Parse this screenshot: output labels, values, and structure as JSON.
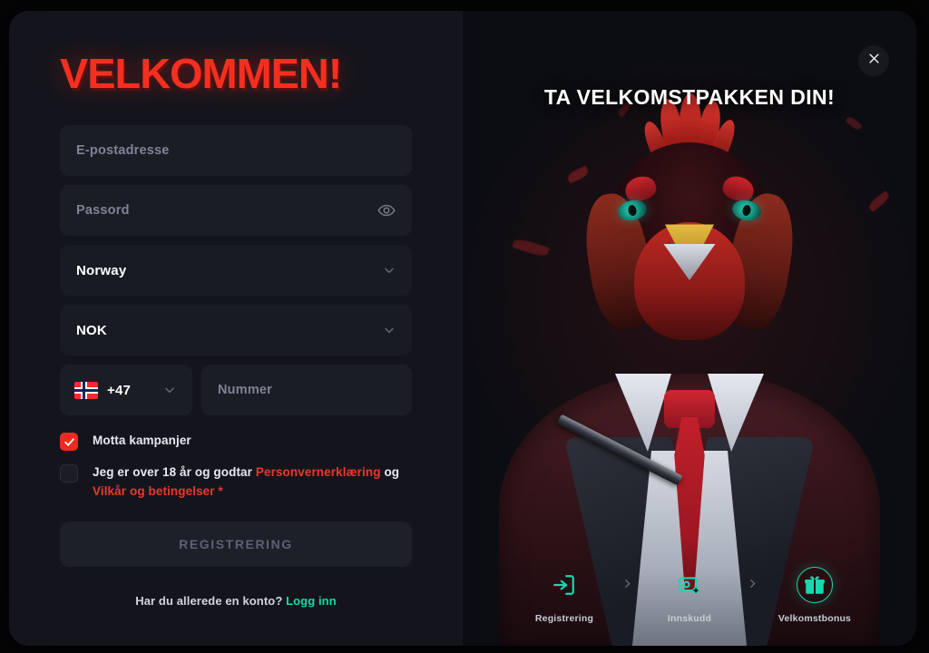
{
  "modal": {
    "close_label": "×",
    "close_icon": "close-icon"
  },
  "form": {
    "title": "VELKOMMEN!",
    "email_placeholder": "E-postadresse",
    "password_placeholder": "Passord",
    "password_toggle_icon": "eye-icon",
    "country_value": "Norway",
    "currency_value": "NOK",
    "country_code_value": "+47",
    "country_flag_icon": "norway-flag-icon",
    "phone_placeholder": "Nummer",
    "chevron_icon": "chevron-down-icon",
    "promo_checkbox": {
      "label": "Motta kampanjer",
      "checked": true
    },
    "terms_checkbox": {
      "text_before": "Jeg er over 18 år og godtar ",
      "link1": "Personvernerklæring",
      "text_middle": " og ",
      "link2": "Vilkår og betingelser",
      "text_after": " *",
      "checked": false
    },
    "submit_label": "REGISTRERING",
    "login_prompt": "Har du allerede en konto?",
    "login_link": "Logg inn"
  },
  "promo": {
    "heading": "TA VELKOMSTPAKKEN DIN!",
    "steps": [
      {
        "label": "Registrering",
        "icon": "login-arrow-icon",
        "active": false
      },
      {
        "label": "Innskudd",
        "icon": "deposit-card-icon",
        "active": false
      },
      {
        "label": "Velkomstbonus",
        "icon": "gift-icon",
        "active": true
      }
    ],
    "step_separator_icon": "chevron-right-icon"
  },
  "colors": {
    "accent_red": "#f52f20",
    "link_red": "#e8392c",
    "accent_teal": "#18d8a6",
    "modal_bg": "#14151c",
    "field_bg": "#1b1d26",
    "checkbox_checked": "#ee2a20"
  }
}
